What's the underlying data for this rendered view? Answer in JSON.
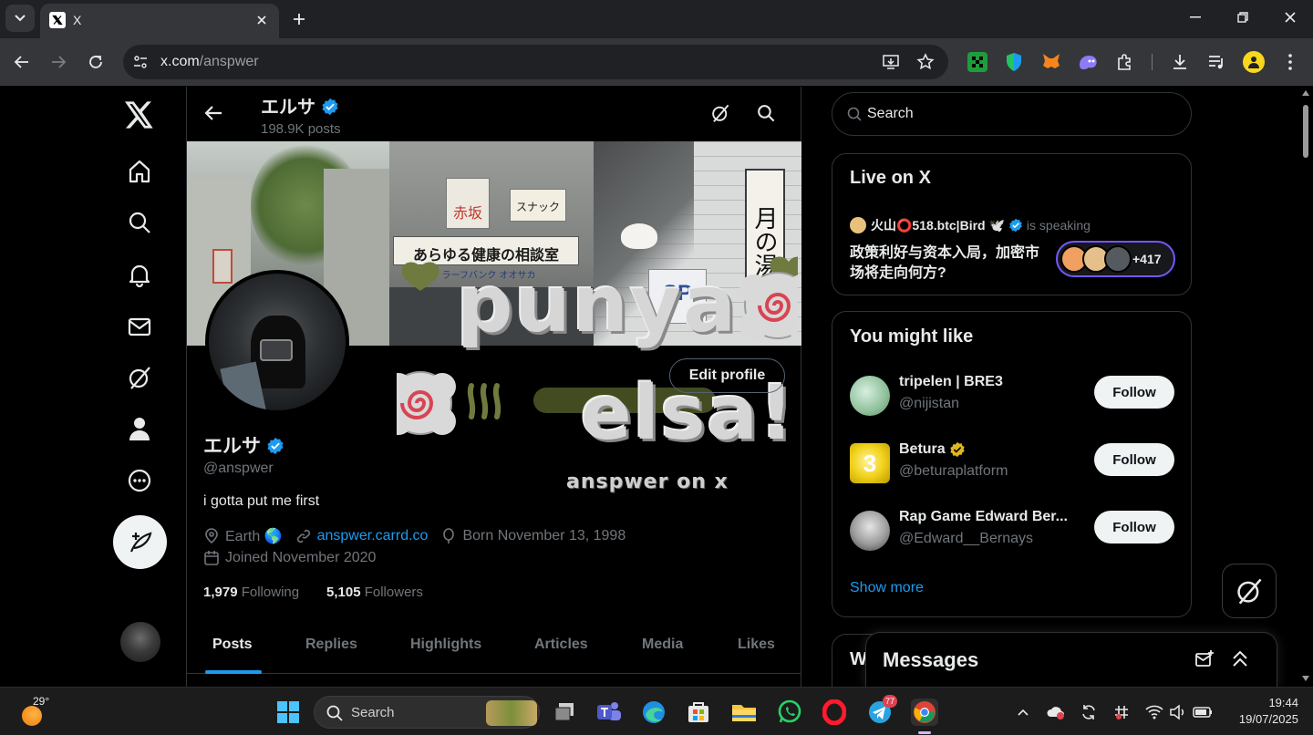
{
  "browser": {
    "tab_title": "X",
    "url_host": "x.com",
    "url_path": "/anspwer"
  },
  "header": {
    "name": "エルサ",
    "post_count": "198.9K posts"
  },
  "banner": {
    "overlay_line1": "punya",
    "overlay_line2": "elsa!",
    "overlay_caption": "anspwer on x",
    "sign_text": "あらゆる健康の相談室",
    "sign_sub": "ラーフバンク オオサカ",
    "sign_vertical": "月の湯",
    "sign_small": "赤坂",
    "sign_snack": "スナック"
  },
  "profile": {
    "edit_label": "Edit profile",
    "name": "エルサ",
    "handle": "@anspwer",
    "bio": "i gotta put me first",
    "location": "Earth 🌎",
    "website": "anspwer.carrd.co",
    "born": "Born November 13, 1998",
    "joined": "Joined November 2020",
    "following_count": "1,979",
    "following_label": "Following",
    "followers_count": "5,105",
    "followers_label": "Followers"
  },
  "tabs": [
    "Posts",
    "Replies",
    "Highlights",
    "Articles",
    "Media",
    "Likes"
  ],
  "search": {
    "placeholder": "Search"
  },
  "live": {
    "title": "Live on X",
    "host": "火山⭕518.btc|Bird 🕊️",
    "status": "is speaking",
    "topic": "政策利好与资本入局，加密市场将走向何方?",
    "listeners": "+417"
  },
  "might_like": {
    "title": "You might like",
    "users": [
      {
        "name": "tripelen | BRE3",
        "handle": "@nijistan",
        "button": "Follow"
      },
      {
        "name": "Betura",
        "handle": "@beturaplatform",
        "button": "Follow"
      },
      {
        "name": "Rap Game Edward Ber...",
        "handle": "@Edward__Bernays",
        "button": "Follow"
      }
    ],
    "show_more": "Show more"
  },
  "messages": {
    "title": "Messages",
    "peek_letter": "W"
  },
  "taskbar": {
    "temperature": "29°",
    "search_label": "Search",
    "telegram_badge": "77",
    "time": "19:44",
    "date": "19/07/2025"
  },
  "colors": {
    "accent_blue": "#1d9bf0",
    "gold_badge": "#e2b719",
    "live_ring": "#7856ff"
  }
}
